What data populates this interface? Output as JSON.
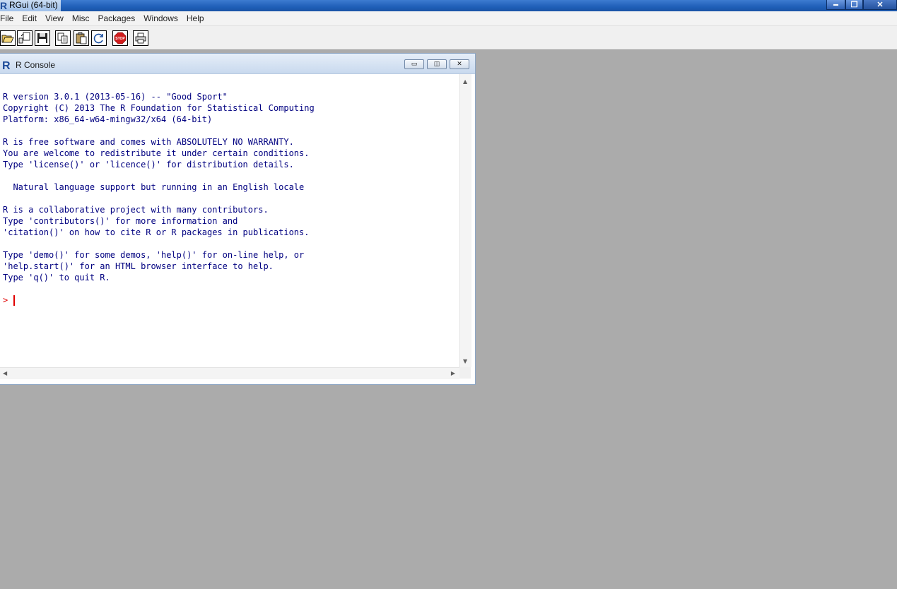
{
  "app": {
    "title": "RGui (64-bit)",
    "icon": "r-logo-icon",
    "window_controls": {
      "minimize": "▬",
      "restore": "❐",
      "close": "✕"
    }
  },
  "menu": {
    "items": [
      "File",
      "Edit",
      "View",
      "Misc",
      "Packages",
      "Windows",
      "Help"
    ]
  },
  "toolbar": {
    "buttons": [
      {
        "name": "open-script",
        "icon": "folder-open-icon"
      },
      {
        "name": "load-workspace",
        "icon": "load-workspace-icon"
      },
      {
        "name": "save-workspace",
        "icon": "floppy-disk-icon"
      },
      {
        "name": "copy",
        "icon": "copy-icon"
      },
      {
        "name": "paste",
        "icon": "paste-icon"
      },
      {
        "name": "copy-paste",
        "icon": "refresh-icon"
      },
      {
        "name": "stop",
        "icon": "stop-sign-icon",
        "label": "STOP"
      },
      {
        "name": "print",
        "icon": "printer-icon"
      }
    ]
  },
  "console": {
    "title": "R Console",
    "controls": {
      "minimize": "▭",
      "restore": "◫",
      "close": "✕"
    },
    "output": "R version 3.0.1 (2013-05-16) -- \"Good Sport\"\nCopyright (C) 2013 The R Foundation for Statistical Computing\nPlatform: x86_64-w64-mingw32/x64 (64-bit)\n\nR is free software and comes with ABSOLUTELY NO WARRANTY.\nYou are welcome to redistribute it under certain conditions.\nType 'license()' or 'licence()' for distribution details.\n\n  Natural language support but running in an English locale\n\nR is a collaborative project with many contributors.\nType 'contributors()' for more information and\n'citation()' on how to cite R or R packages in publications.\n\nType 'demo()' for some demos, 'help()' for on-line help, or\n'help.start()' for an HTML browser interface to help.\nType 'q()' to quit R.",
    "prompt": ">",
    "text_color": "#000080",
    "prompt_color": "#e00000"
  },
  "colors": {
    "workspace_bg": "#ababab",
    "titlebar": "#1f5fb8"
  }
}
